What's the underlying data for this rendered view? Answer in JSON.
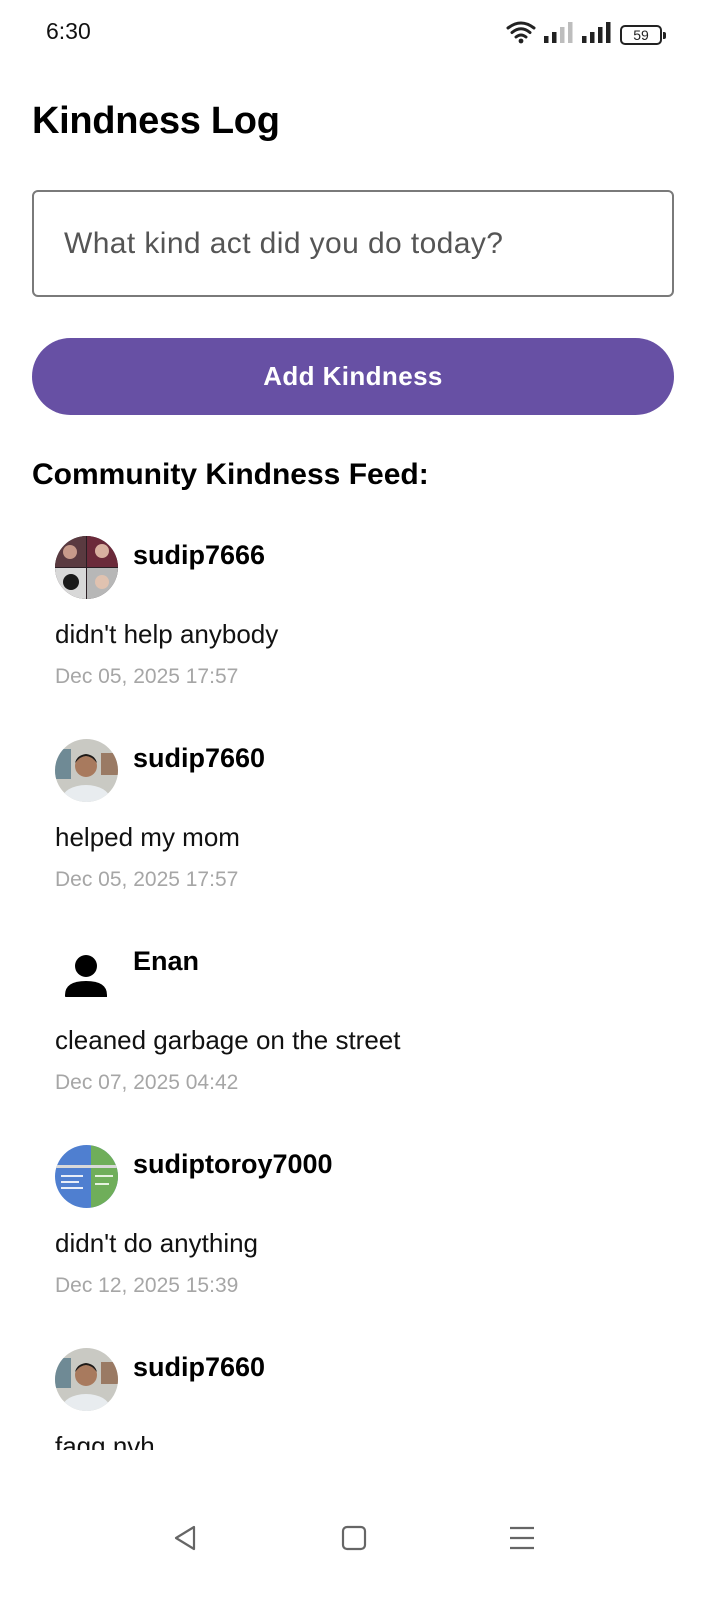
{
  "status_bar": {
    "time": "6:30",
    "battery": "59",
    "icons": [
      "wifi-icon",
      "signal-sim1-icon",
      "signal-sim2-icon",
      "battery-icon"
    ]
  },
  "page": {
    "title": "Kindness Log"
  },
  "input": {
    "placeholder": "What kind act did you do today?",
    "value": ""
  },
  "add_button": {
    "label": "Add Kindness",
    "color": "#6750a4"
  },
  "feed": {
    "title": "Community Kindness Feed:",
    "items": [
      {
        "username": "sudip7666",
        "message": "didn't help anybody",
        "timestamp": "Dec 05, 2025 17:57",
        "avatar": "collage-photo"
      },
      {
        "username": "sudip7660",
        "message": "helped my mom",
        "timestamp": "Dec 05, 2025 17:57",
        "avatar": "profile-photo"
      },
      {
        "username": "Enan",
        "message": "cleaned garbage on the street",
        "timestamp": "Dec 07, 2025 04:42",
        "avatar": "default-person-icon"
      },
      {
        "username": "sudiptoroy7000",
        "message": "didn't do anything",
        "timestamp": "Dec 12, 2025 15:39",
        "avatar": "screenshot-photo"
      },
      {
        "username": "sudip7660",
        "message": "fagg nvh",
        "timestamp": "",
        "avatar": "profile-photo"
      }
    ]
  },
  "nav_bar": {
    "buttons": [
      "back-icon",
      "home-icon",
      "recents-icon"
    ]
  },
  "colors": {
    "accent": "#6750a4",
    "timestamp": "#a6a6a6",
    "input_border": "#7a7a7a"
  }
}
